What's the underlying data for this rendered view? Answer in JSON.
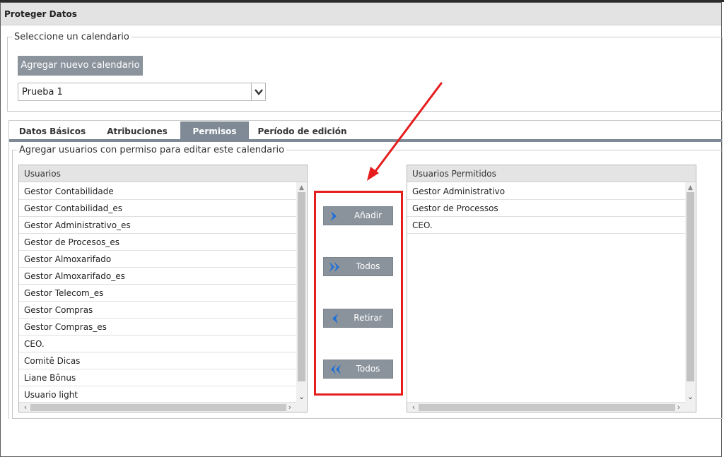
{
  "window": {
    "title": "Proteger Datos"
  },
  "calendar_section": {
    "legend": "Seleccione un calendario",
    "add_button": "Agregar nuevo calendario",
    "select_value": "Prueba 1"
  },
  "tabs": [
    {
      "label": "Datos Básicos",
      "active": false
    },
    {
      "label": "Atribuciones",
      "active": false
    },
    {
      "label": "Permisos",
      "active": true
    },
    {
      "label": "Período de edición",
      "active": false
    }
  ],
  "permissions": {
    "legend": "Agregar usuarios con permiso para editar este calendario",
    "available": {
      "header": "Usuarios",
      "items": [
        "Gestor Contabilidade",
        "Gestor Contabilidad_es",
        "Gestor Administrativo_es",
        "Gestor de Procesos_es",
        "Gestor Almoxarifado",
        "Gestor Almoxarifado_es",
        "Gestor Telecom_es",
        "Gestor Compras",
        "Gestor Compras_es",
        "CEO.",
        "Comitê Dicas",
        "Liane Bônus",
        "Usuario light"
      ]
    },
    "allowed": {
      "header": "Usuarios Permitidos",
      "items": [
        "Gestor Administrativo",
        "Gestor de Processos",
        "CEO."
      ]
    },
    "transfer_buttons": {
      "add": "Añadir",
      "add_all": "Todos",
      "remove": "Retirar",
      "remove_all": "Todos"
    }
  },
  "icons": {
    "add": "chevron-right-icon",
    "add_all": "double-chevron-right-icon",
    "remove": "chevron-left-icon",
    "remove_all": "double-chevron-left-icon",
    "select_arrow": "chevron-down-icon"
  },
  "colors": {
    "button_bg": "#8a939c",
    "active_tab": "#7f8a96",
    "annotation_red": "#e51d1d",
    "icon_blue": "#1e6fd9"
  }
}
